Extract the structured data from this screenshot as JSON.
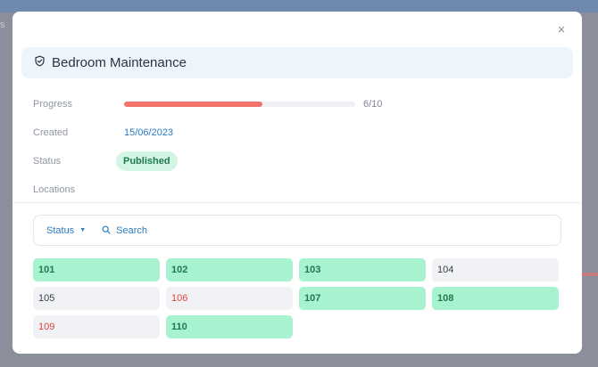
{
  "backdrop": {
    "edge_text": "s"
  },
  "modal": {
    "close_label": "×",
    "title": "Bedroom Maintenance",
    "title_icon": "shield-check-icon"
  },
  "details": {
    "progress_label": "Progress",
    "progress_text": "6/10",
    "progress_fraction": 0.6,
    "created_label": "Created",
    "created_value": "15/06/2023",
    "status_label": "Status",
    "status_value": "Published",
    "locations_label": "Locations"
  },
  "filter": {
    "status_label": "Status",
    "search_placeholder": "Search"
  },
  "locations": [
    {
      "id": "101",
      "state": "green"
    },
    {
      "id": "102",
      "state": "green"
    },
    {
      "id": "103",
      "state": "green"
    },
    {
      "id": "104",
      "state": "gray"
    },
    {
      "id": "105",
      "state": "gray"
    },
    {
      "id": "106",
      "state": "red"
    },
    {
      "id": "107",
      "state": "green"
    },
    {
      "id": "108",
      "state": "green"
    },
    {
      "id": "109",
      "state": "red"
    },
    {
      "id": "110",
      "state": "green"
    }
  ],
  "colors": {
    "accent": "#2b7bbf",
    "progress": "#f3736d",
    "done": "#a7f2cf",
    "pending": "#f0f2f6",
    "issue_text": "#e0443c"
  }
}
